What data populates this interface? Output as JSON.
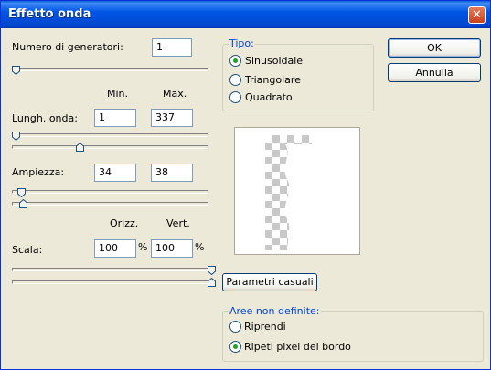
{
  "window": {
    "title": "Effetto onda",
    "close_glyph": "✕",
    "close_icon": "close-icon"
  },
  "generators": {
    "label": "Numero di generatori:",
    "value": "1",
    "slider_level": 0.0
  },
  "headers": {
    "min": "Min.",
    "max": "Max."
  },
  "wavelength": {
    "label": "Lungh. onda:",
    "min": "1",
    "max": "337",
    "slider_min_level": 0.0,
    "slider_max_level": 0.34
  },
  "amplitude": {
    "label": "Ampiezza:",
    "min": "34",
    "max": "38",
    "slider_min_level": 0.03,
    "slider_max_level": 0.04
  },
  "scale_headers": {
    "horiz": "Orizz.",
    "vert": "Vert."
  },
  "scale": {
    "label": "Scala:",
    "horiz": "100",
    "vert": "100",
    "percent": "%",
    "slider_horiz_level": 1.0,
    "slider_vert_level": 1.0
  },
  "type_group": {
    "legend": "Tipo:",
    "options": [
      {
        "label": "Sinusoidale",
        "selected": true
      },
      {
        "label": "Triangolare",
        "selected": false
      },
      {
        "label": "Quadrato",
        "selected": false
      }
    ]
  },
  "undefined_group": {
    "legend": "Aree non definite:",
    "options": [
      {
        "label": "Riprendi",
        "selected": false
      },
      {
        "label": "Ripeti pixel del bordo",
        "selected": true
      }
    ]
  },
  "buttons": {
    "ok": "OK",
    "cancel": "Annulla",
    "random": "Parametri casuali"
  },
  "colors": {
    "title_bar": "#0055e5",
    "dialog_bg": "#ece9d8",
    "legend_text": "#0046d5",
    "radio_dot": "#21a121"
  }
}
